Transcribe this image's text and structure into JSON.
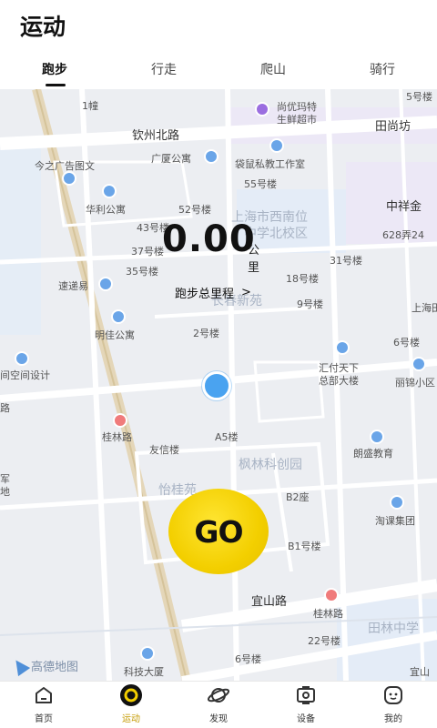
{
  "header": {
    "title": "运动"
  },
  "tabs": [
    {
      "label": "跑步",
      "active": true
    },
    {
      "label": "行走",
      "active": false
    },
    {
      "label": "爬山",
      "active": false
    },
    {
      "label": "骑行",
      "active": false
    }
  ],
  "stats": {
    "distance_value": "0.00",
    "distance_unit": "公里",
    "caption": "跑步总里程",
    "caption_chevron": ">"
  },
  "go_button": {
    "label": "GO",
    "color": "#f3cf00"
  },
  "map": {
    "brand": "高德地图",
    "labels": {
      "qinzhou_road": "钦州北路",
      "tianshangfang": "田尚坊",
      "shangyoumate": "尚优玛特",
      "shengxian": "生鲜超市",
      "jinzhiguang": "今之广告图文",
      "guangsha": "广厦公寓",
      "daishu": "袋鼠私教工作室",
      "huali": "华利公寓",
      "building52": "52号楼",
      "building55": "55号楼",
      "shanghai_school": "上海市西南位",
      "middle_school": "中学北校区",
      "zhongxiang": "中祥金",
      "building43": "43号楼",
      "building37": "37号楼",
      "building35": "35号楼",
      "building628": "628弄24",
      "building31": "31号楼",
      "building18": "18号楼",
      "building9": "9号楼",
      "suyie": "速递易",
      "changchun": "长春新苑",
      "mingjia": "明佳公寓",
      "building2": "2号楼",
      "building6": "6号楼",
      "huifu1": "汇付天下",
      "huifu2": "总部大楼",
      "lijin": "丽锦小区",
      "shanghai_tian": "上海田林",
      "space_design": "间空间设计",
      "guilin_road": "桂林路",
      "youxin": "友信楼",
      "a5": "A5楼",
      "fenglin": "枫林科创园",
      "langsheng": "朗盛教育",
      "yigui": "怡桂苑",
      "b2": "B2座",
      "taoke": "淘课集团",
      "b1": "B1号楼",
      "guilin_vertical": "桂林路",
      "yishan": "宜山路",
      "guilin_road2": "桂林路",
      "tianlin_mid": "田林中学",
      "building22": "22号楼",
      "building6b": "6号楼",
      "keji": "科技大厦",
      "building1": "1幢",
      "building5": "5号楼",
      "yishan2": "宜山",
      "jun": "军",
      "di": "地",
      "lu": "路",
      "qu": "区"
    }
  },
  "bottom_nav": [
    {
      "label": "首页",
      "icon": "home-icon",
      "active": false
    },
    {
      "label": "运动",
      "icon": "sport-icon",
      "active": true
    },
    {
      "label": "发现",
      "icon": "planet-icon",
      "active": false
    },
    {
      "label": "设备",
      "icon": "device-icon",
      "active": false
    },
    {
      "label": "我的",
      "icon": "profile-icon",
      "active": false
    }
  ],
  "colors": {
    "accent": "#f3cf00",
    "active_nav": "#c49a00",
    "location": "#4aa3f0"
  }
}
